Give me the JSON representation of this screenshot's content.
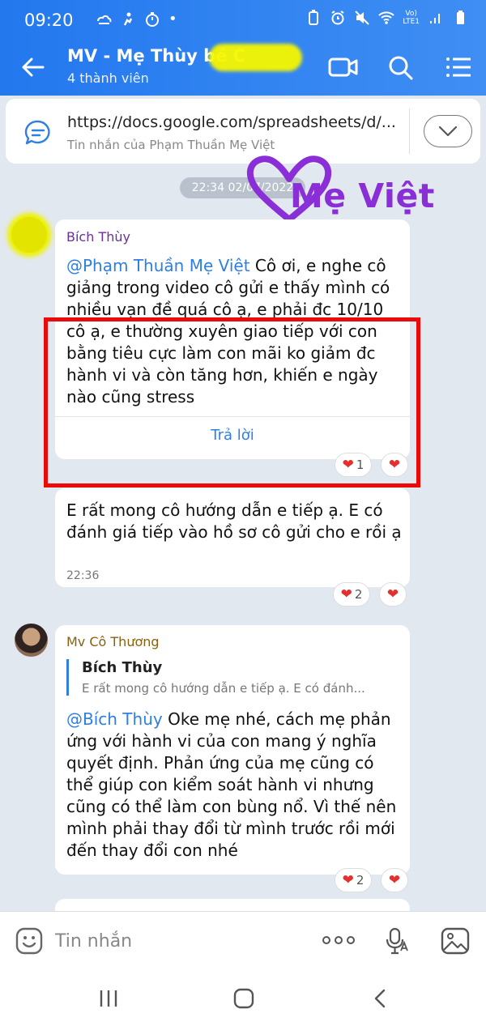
{
  "status_bar": {
    "time": "09:20",
    "dot": "•",
    "network_label": "LTE1",
    "volte_label": "Vo)"
  },
  "header": {
    "title": "MV - Mẹ Thùy bé C",
    "subtitle": "4 thành viên"
  },
  "pinned": {
    "link": "https://docs.google.com/spreadsheets/d/...",
    "sender_note": "Tin nhắn của Phạm Thuần Mẹ Việt"
  },
  "chat": {
    "date_divider": "22:34 02/07/2022",
    "watermark": "Mẹ Việt",
    "messages": [
      {
        "sender": "Bích Thùy",
        "mention": "@Phạm Thuần Mẹ Việt",
        "text": " Cô ơi, e nghe cô giảng trong video cô gửi e thấy mình có nhiều vạn đề quá cô ạ, e phải đc 10/10 cô ạ, e thường xuyên giao tiếp với con bằng tiêu cực làm con mãi ko giảm đc hành vi và còn tăng hơn, khiến e ngày nào cũng stress",
        "reply_label": "Trả lời",
        "reaction_count": "1"
      },
      {
        "text": "E rất mong cô hướng dẫn e tiếp ạ. E có đánh giá tiếp vào hồ sơ cô gửi cho e rồi ạ",
        "time": "22:36",
        "reaction_count": "2"
      },
      {
        "sender": "Mv Cô Thương",
        "quote_name": "Bích Thùy",
        "quote_text": "E rất mong cô hướng dẫn e tiếp ạ. E có đánh...",
        "mention": "@Bích Thùy",
        "text": " Oke mẹ nhé, cách mẹ phản ứng với hành vi của con mang ý nghĩa quyết định. Phản ứng của mẹ cũng có thể giúp con kiểm soát hành vi nhưng cũng có thể làm con bùng nổ. Vì thế nên mình phải thay đổi từ mình trước rồi mới đến thay đổi con nhé",
        "reaction_count": "2"
      }
    ]
  },
  "input": {
    "placeholder": "Tin nhắn"
  },
  "icons": {
    "heart": "❤",
    "back": "back-arrow-icon",
    "video": "video-call-icon",
    "search": "search-icon",
    "menu": "menu-icon"
  },
  "colors": {
    "header_blue": "#2378ee",
    "link_blue": "#2e7fe0",
    "sender_purple": "#6b2fa0",
    "sender_brown": "#8a6010",
    "highlight_red": "#ea0a0a",
    "watermark_purple": "#8a2ed8"
  }
}
